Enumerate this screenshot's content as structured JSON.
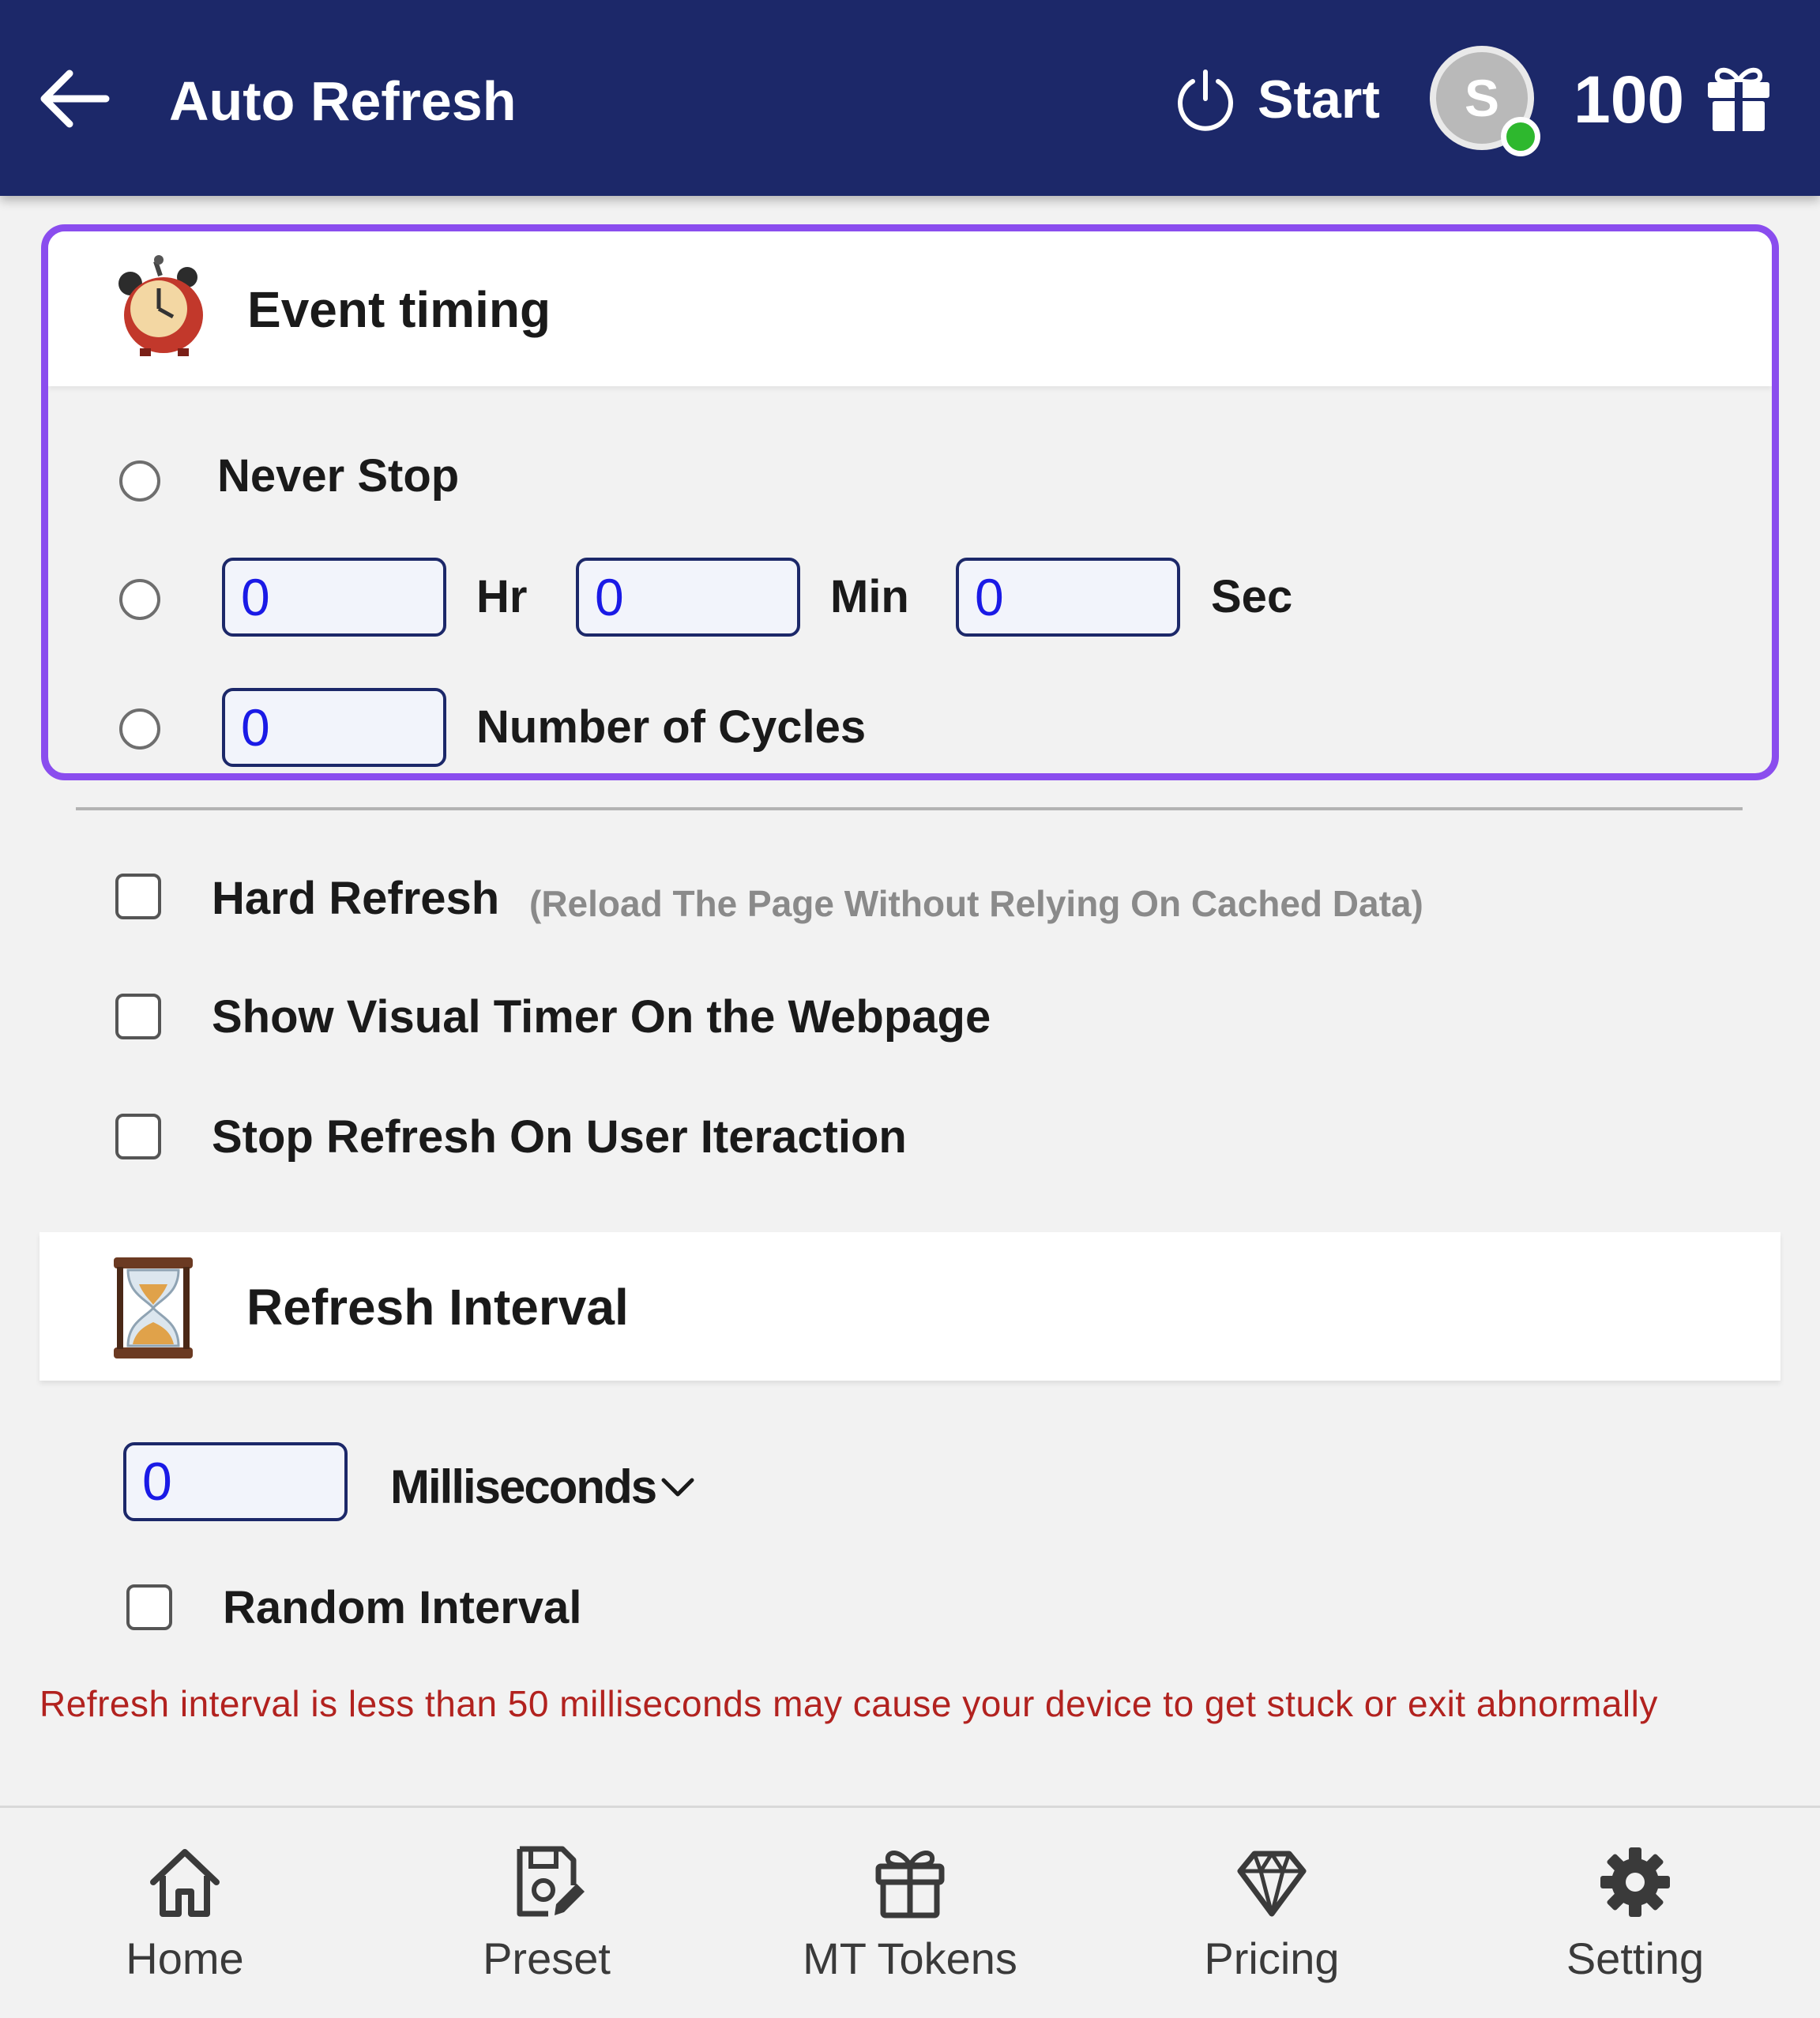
{
  "header": {
    "title": "Auto Refresh",
    "start_label": "Start",
    "avatar_letter": "S",
    "credits": "100",
    "background_color": "#1c2869",
    "online_color": "#2eb82e"
  },
  "event_timing": {
    "title": "Event timing",
    "icon": "alarm-clock-icon",
    "border_color": "#8a4dee",
    "never_stop_label": "Never Stop",
    "hours_value": "0",
    "hours_label": "Hr",
    "minutes_value": "0",
    "minutes_label": "Min",
    "seconds_value": "0",
    "seconds_label": "Sec",
    "cycles_value": "0",
    "cycles_label": "Number of Cycles"
  },
  "options": {
    "hard_refresh_label": "Hard Refresh",
    "hard_refresh_note": "(Reload The Page Without Relying On Cached Data)",
    "visual_timer_label": "Show Visual Timer On the Webpage",
    "stop_on_interaction_label": "Stop Refresh On User Iteraction"
  },
  "refresh_interval": {
    "title": "Refresh Interval",
    "icon": "hourglass-icon",
    "value": "0",
    "unit": "Milliseconds",
    "random_label": "Random Interval",
    "warning": "Refresh interval is less than 50 milliseconds may cause your device to get stuck or exit abnormally",
    "warning_color": "#b2221f"
  },
  "nav": {
    "items": [
      {
        "label": "Home",
        "icon": "home-icon"
      },
      {
        "label": "Preset",
        "icon": "preset-icon"
      },
      {
        "label": "MT Tokens",
        "icon": "gift-icon"
      },
      {
        "label": "Pricing",
        "icon": "diamond-icon"
      },
      {
        "label": "Setting",
        "icon": "gear-icon"
      }
    ]
  }
}
